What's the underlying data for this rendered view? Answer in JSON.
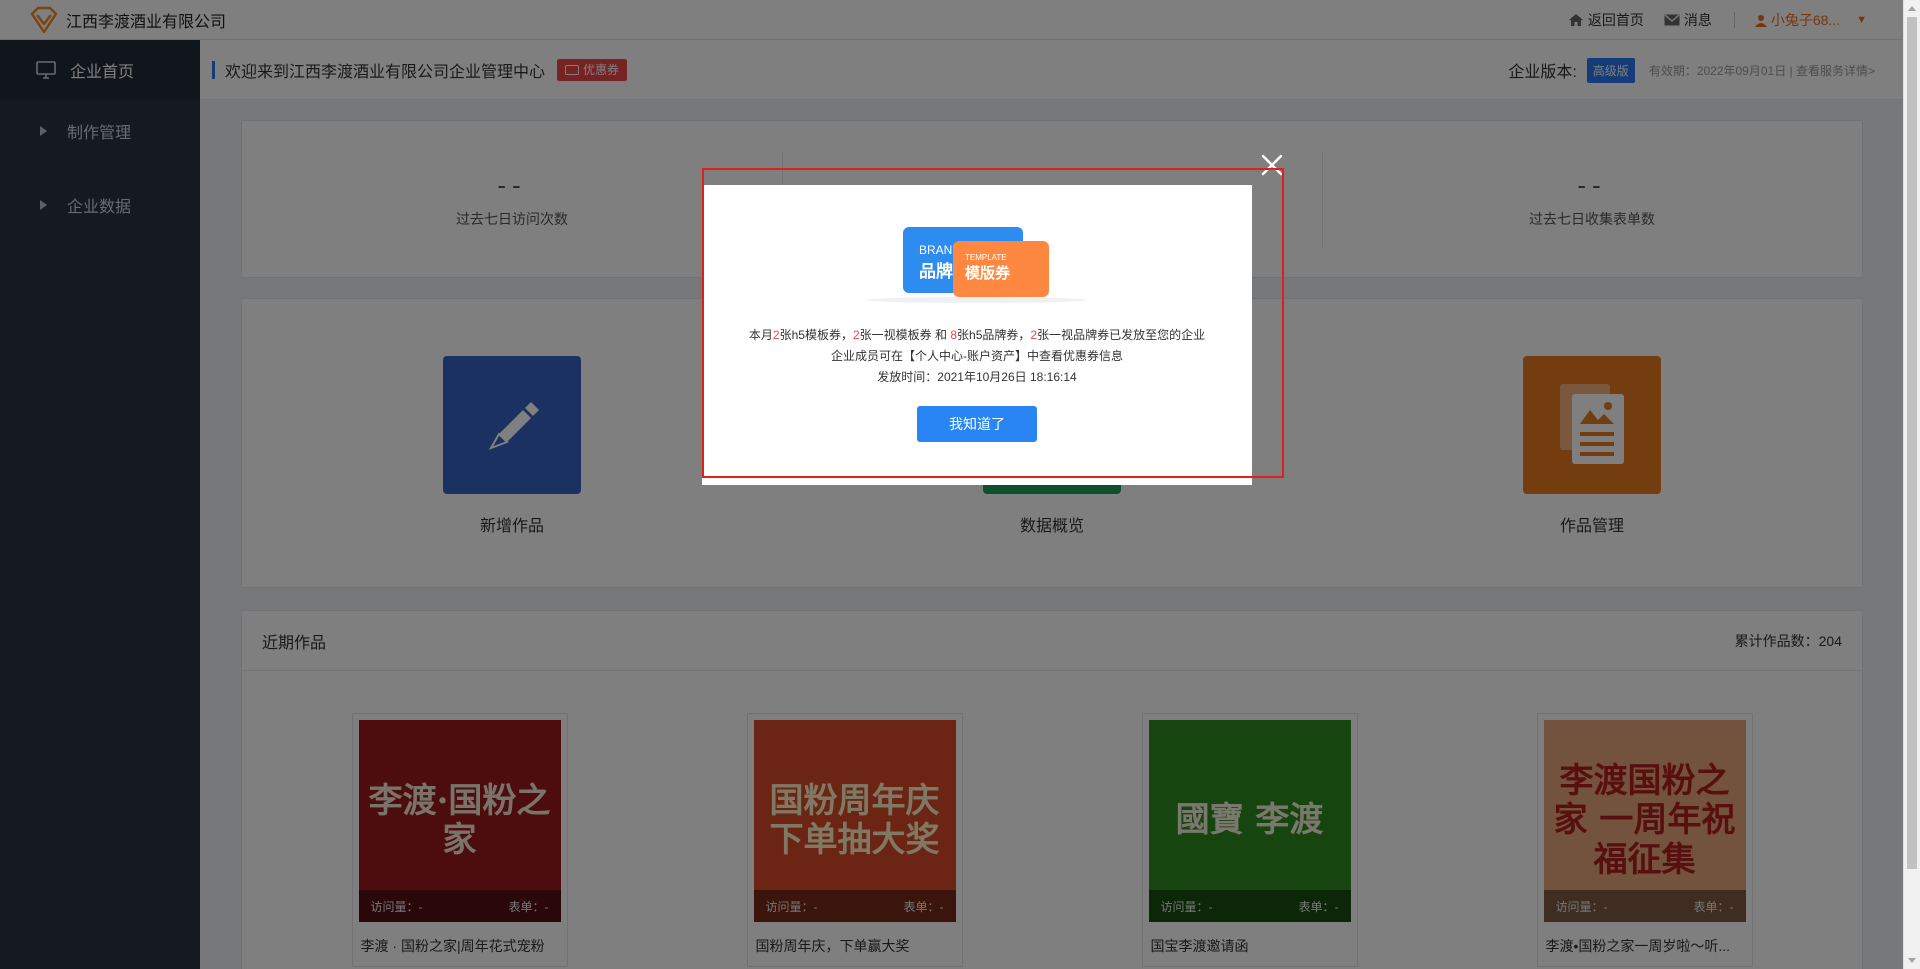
{
  "brand": {
    "name": "江西李渡酒业有限公司",
    "logo_icon": "diamond-logo-icon"
  },
  "topnav": {
    "home_label": "返回首页",
    "messages_label": "消息",
    "user_label": "小兔子68..."
  },
  "sidebar": {
    "items": [
      {
        "label": "企业首页",
        "icon": "monitor-icon",
        "active": true
      },
      {
        "label": "制作管理",
        "icon": "triangle-right-icon"
      },
      {
        "label": "企业数据",
        "icon": "triangle-right-icon"
      }
    ]
  },
  "header": {
    "welcome": "欢迎来到江西李渡酒业有限公司企业管理中心",
    "coupon_tag": "优惠券",
    "version_label": "企业版本:",
    "version_badge": "高级版",
    "expire_text": "有效期：2022年09月01日 | 查看服务详情>"
  },
  "stats": [
    {
      "value": "--",
      "label": "过去七日访问次数"
    },
    {
      "value": "--",
      "label": ""
    },
    {
      "value": "--",
      "label": "过去七日收集表单数"
    }
  ],
  "actions": [
    {
      "label": "新增作品",
      "icon": "pen-icon",
      "color": "#3763c4"
    },
    {
      "label": "数据概览",
      "icon": "chart-icon",
      "color": "#1f9e58"
    },
    {
      "label": "作品管理",
      "icon": "document-icon",
      "color": "#e87a1e"
    }
  ],
  "recent": {
    "title": "近期作品",
    "count_label": "累计作品数：204",
    "works": [
      {
        "title": "李渡 · 国粉之家|周年花式宠粉",
        "visits_label": "访问量：-",
        "forms_label": "表单：-",
        "art": "李渡·国粉之家",
        "bg": "#9a1a1e",
        "fg": "#f3e9d2"
      },
      {
        "title": "国粉周年庆，下单赢大奖",
        "visits_label": "访问量：-",
        "forms_label": "表单：-",
        "art": "国粉周年庆 下单抽大奖",
        "bg": "#d94a2a",
        "fg": "#fff2c9"
      },
      {
        "title": "国宝李渡邀请函",
        "visits_label": "访问量：-",
        "forms_label": "表单：-",
        "art": "國寶 李渡",
        "bg": "#2f8a1f",
        "fg": "#f4f0d8"
      },
      {
        "title": "李渡•国粉之家一周岁啦～听...",
        "visits_label": "访问量：-",
        "forms_label": "表单：-",
        "art": "李渡国粉之家 一周年祝福征集",
        "bg": "#e7a77a",
        "fg": "#b0201e"
      }
    ]
  },
  "modal": {
    "ticket_a_small": "BRAND",
    "ticket_a_big": "品牌",
    "ticket_b_small": "TEMPLATE",
    "ticket_b_big": "模版券",
    "line1_parts": [
      "本月",
      "2",
      "张h5模板券，",
      "2",
      "张一视模板券 和 ",
      "8",
      "张h5品牌券，",
      "2",
      "张一视品牌券已发放至您的企业"
    ],
    "line2": "企业成员可在【个人中心-账户资产】中查看优惠券信息",
    "line3": "发放时间：2021年10月26日 18:16:14",
    "ok_label": "我知道了"
  },
  "colors": {
    "accent": "#2a79f2",
    "danger": "#f04646",
    "orange": "#f06a1a",
    "sidebar": "#2a3242"
  }
}
